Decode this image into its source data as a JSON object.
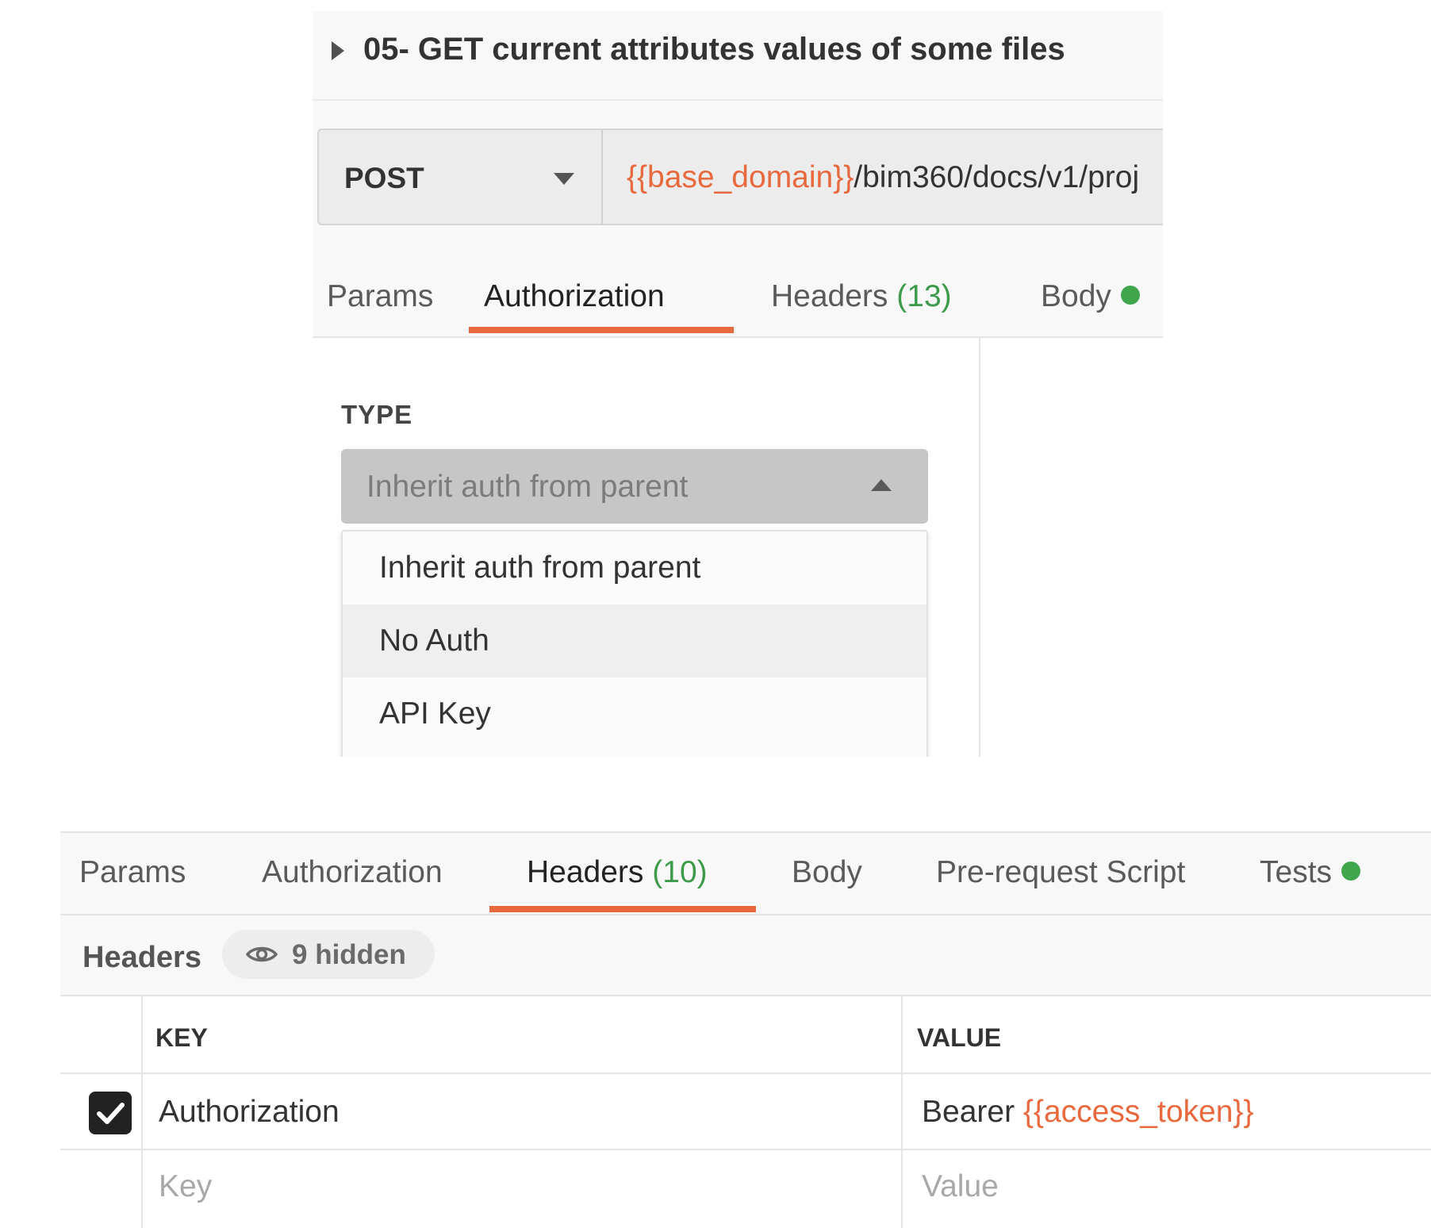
{
  "request": {
    "title": "05- GET current attributes values of some files",
    "method": "POST",
    "url_variable": "{{base_domain}}",
    "url_path": "/bim360/docs/v1/proj"
  },
  "top_tabs": [
    {
      "label": "Params"
    },
    {
      "label": "Authorization",
      "active": true
    },
    {
      "label": "Headers",
      "count": "(13)"
    },
    {
      "label": "Body",
      "dot": true
    }
  ],
  "auth": {
    "type_label": "TYPE",
    "selected": "Inherit auth from parent",
    "options": [
      "Inherit auth from parent",
      "No Auth",
      "API Key"
    ]
  },
  "bottom_tabs": [
    {
      "label": "Params"
    },
    {
      "label": "Authorization"
    },
    {
      "label": "Headers",
      "count": "(10)",
      "active": true
    },
    {
      "label": "Body"
    },
    {
      "label": "Pre-request Script"
    },
    {
      "label": "Tests",
      "dot": true
    }
  ],
  "headers_section": {
    "title": "Headers",
    "hidden_label": "9 hidden",
    "columns": {
      "key": "KEY",
      "value": "VALUE"
    },
    "rows": [
      {
        "checked": true,
        "key": "Authorization",
        "value_prefix": "Bearer ",
        "value_variable": "{{access_token}}"
      }
    ],
    "key_placeholder": "Key",
    "value_placeholder": "Value"
  },
  "colors": {
    "accent": "#e8693d",
    "count_green": "#3f9b4c",
    "dot_green": "#3fa64c"
  }
}
